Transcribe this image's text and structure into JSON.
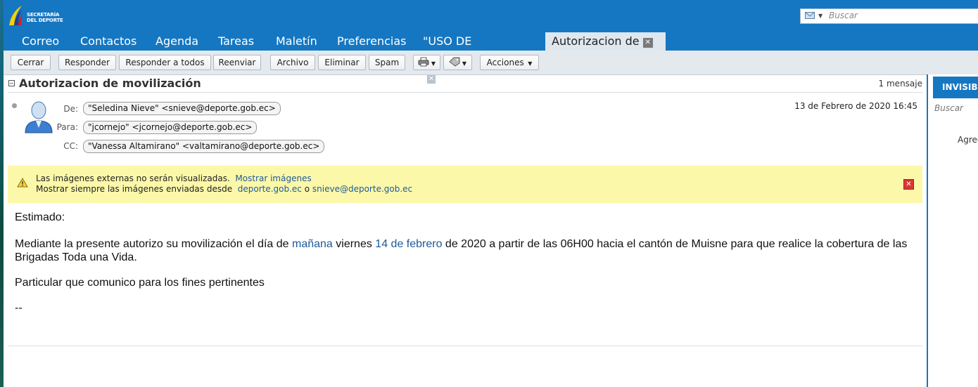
{
  "app": {
    "logo_line1": "SECRETARÍA",
    "logo_line2": "DEL DEPORTE"
  },
  "search": {
    "placeholder": "Buscar"
  },
  "tabs": [
    {
      "label": "Correo"
    },
    {
      "label": "Contactos"
    },
    {
      "label": "Agenda"
    },
    {
      "label": "Tareas"
    },
    {
      "label": "Maletín"
    },
    {
      "label": "Preferencias"
    },
    {
      "label": "\"USO DE CREDENC"
    },
    {
      "label": "Autorizacion de"
    }
  ],
  "toolbar": {
    "close": "Cerrar",
    "reply": "Responder",
    "reply_all": "Responder a todos",
    "forward": "Reenviar",
    "archive": "Archivo",
    "delete": "Eliminar",
    "spam": "Spam",
    "actions": "Acciones"
  },
  "conversation": {
    "subject": "Autorizacion de movilización",
    "count": "1 mensaje"
  },
  "message": {
    "from_label": "De:",
    "from": "\"Seledina Nieve\" <snieve@deporte.gob.ec>",
    "to_label": "Para:",
    "to": "\"jcornejo\" <jcornejo@deporte.gob.ec>",
    "cc_label": "CC:",
    "cc": "\"Vanessa Altamirano\" <valtamirano@deporte.gob.ec>",
    "date": "13 de Febrero de 2020 16:45"
  },
  "warning": {
    "text1": "Las imágenes externas no serán visualizadas.",
    "show_images": "Mostrar imágenes",
    "text2": "Mostrar siempre las imágenes enviadas desde",
    "domain": "deporte.gob.ec",
    "or": "o",
    "sender": "snieve@deporte.gob.ec"
  },
  "body": {
    "greeting": "Estimado:",
    "p1_a": "Mediante la presente autorizo su movilización el día de ",
    "p1_link1": "mañana",
    "p1_b": " viernes ",
    "p1_link2": "14 de febrero",
    "p1_c": " de 2020 a partir de las 06H00 hacia el cantón de Muisne para que realice la cobertura de las Brigadas Toda una Vida.",
    "p2": "Particular que comunico para los fines pertinentes",
    "sig": "--"
  },
  "right_panel": {
    "header": "INVISIBL",
    "search": "Buscar",
    "add": "Agreg"
  },
  "colors": {
    "brand_blue": "#1577c2",
    "warning_bg": "#fcf8a9",
    "link": "#1d5a9a"
  }
}
